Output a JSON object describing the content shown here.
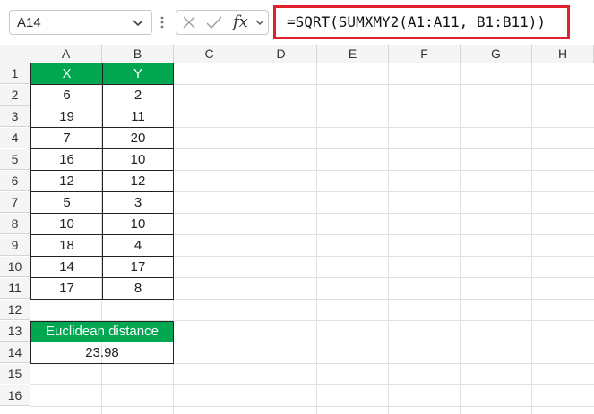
{
  "formula_bar": {
    "name_box": "A14",
    "fx_label": "fx",
    "formula": "=SQRT(SUMXMY2(A1:A11, B1:B11))",
    "highlight_color": "#e0202a",
    "icons": [
      "chevron-down-icon",
      "more-vertical-icon",
      "cancel-icon",
      "enter-check-icon",
      "function-icon"
    ]
  },
  "sheet": {
    "columns": [
      "A",
      "B",
      "C",
      "D",
      "E",
      "F",
      "G",
      "H"
    ],
    "rows": [
      "1",
      "2",
      "3",
      "4",
      "5",
      "6",
      "7",
      "8",
      "9",
      "10",
      "11",
      "12",
      "13",
      "14",
      "15",
      "16"
    ],
    "table": {
      "header": [
        "X",
        "Y"
      ],
      "header_color": "#00a650",
      "rows": [
        [
          "6",
          "2"
        ],
        [
          "19",
          "11"
        ],
        [
          "7",
          "20"
        ],
        [
          "16",
          "10"
        ],
        [
          "12",
          "12"
        ],
        [
          "5",
          "3"
        ],
        [
          "10",
          "10"
        ],
        [
          "18",
          "4"
        ],
        [
          "14",
          "17"
        ],
        [
          "17",
          "8"
        ]
      ]
    },
    "result": {
      "label": "Euclidean distance",
      "value": "23.98"
    }
  }
}
